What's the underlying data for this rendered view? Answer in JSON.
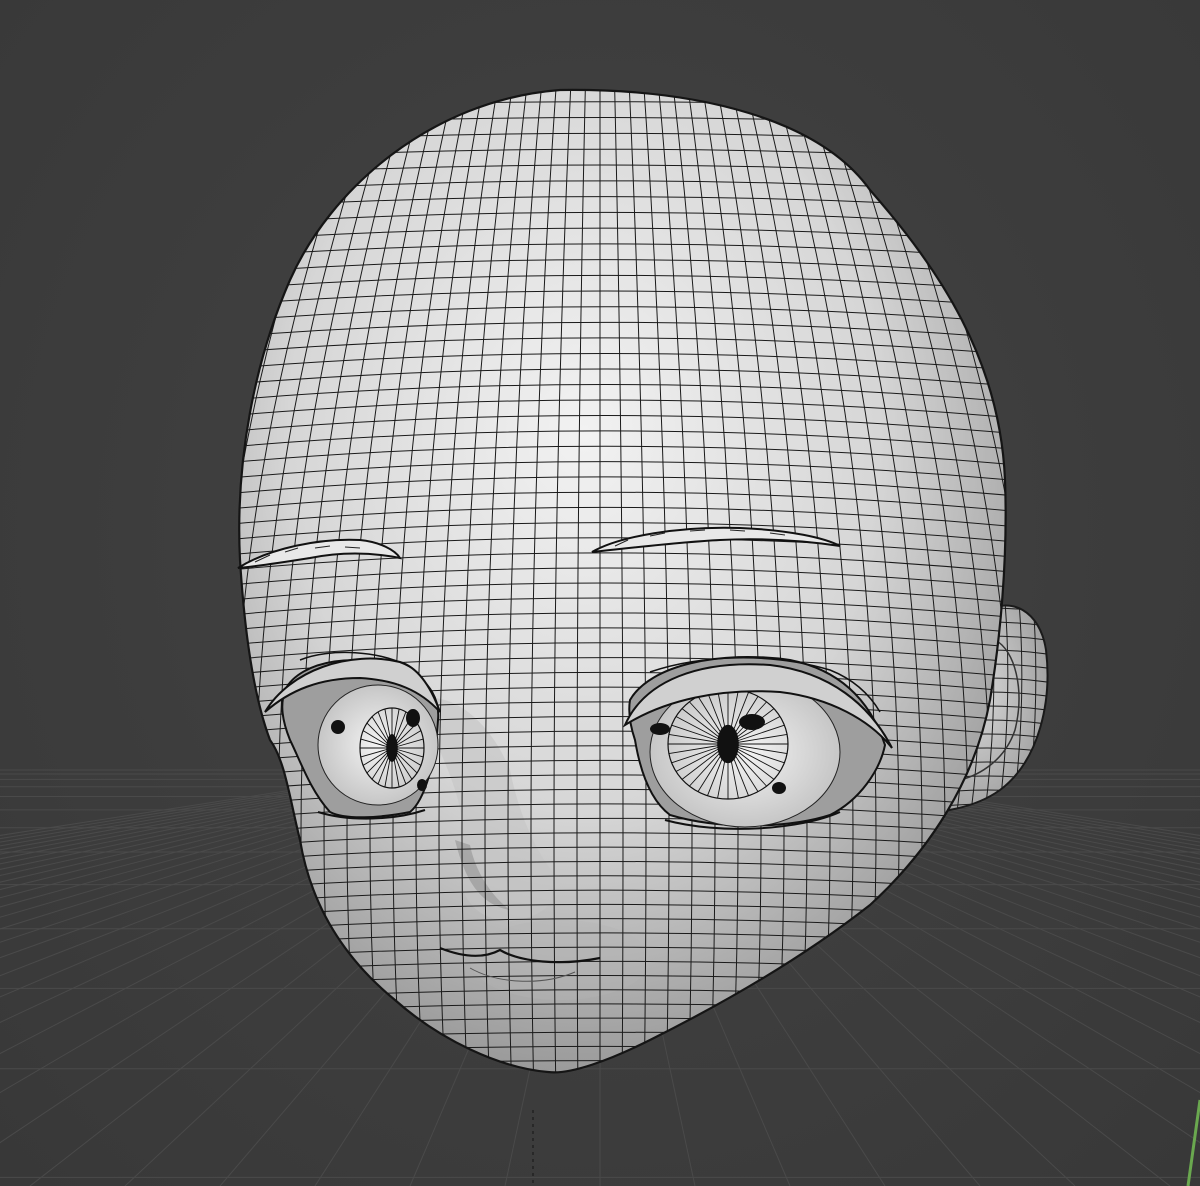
{
  "viewport": {
    "mode": "3d-viewport-wireframe-overlay",
    "background_color": "#3d3d3d",
    "grid_color": "#4a4a4a",
    "mesh_color": "#d9d9d9",
    "wire_color": "#1a1a1a",
    "origin_axis_color": "#6aa84f"
  },
  "object": {
    "kind": "anime-style head mesh",
    "parts": [
      "head",
      "left-eye",
      "right-eye",
      "left-eyebrow",
      "right-eyebrow",
      "right-ear",
      "nose",
      "mouth"
    ]
  }
}
